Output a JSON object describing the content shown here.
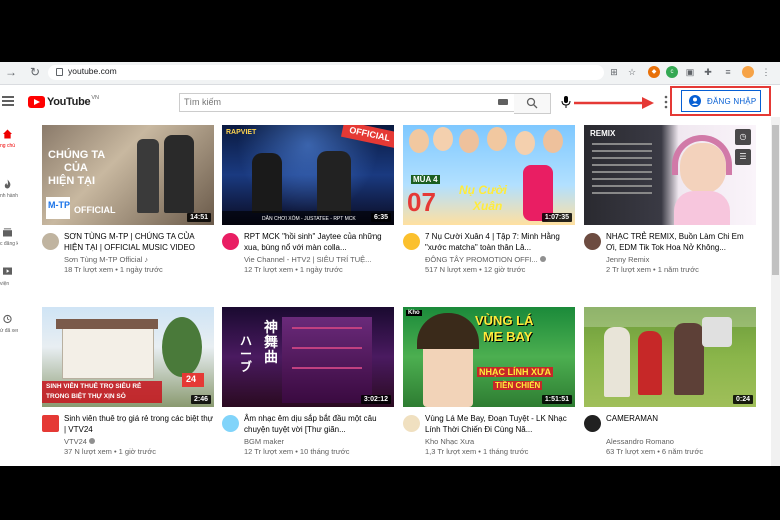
{
  "browser": {
    "url": "youtube.com"
  },
  "header": {
    "logo_text": "YouTube",
    "region": "VN",
    "search_placeholder": "Tìm kiếm",
    "signin_label": "ĐĂNG NHẬP",
    "colors": {
      "accent": "#065fd4",
      "brand": "#ff0000",
      "highlight": "#e53935"
    }
  },
  "sidebar": {
    "items": [
      {
        "label": "ng chủ",
        "icon": "home-icon"
      },
      {
        "label": "nh hành",
        "icon": "trending-icon"
      },
      {
        "label": "c đăng ký",
        "icon": "subscriptions-icon"
      },
      {
        "label": "viện",
        "icon": "library-icon"
      },
      {
        "label": "ử đã xem",
        "icon": "history-icon"
      }
    ]
  },
  "videos": [
    {
      "title": "SƠN TÙNG M-TP | CHÚNG TA CỦA HIỆN TẠI | OFFICIAL MUSIC VIDEO",
      "channel": "Sơn Tùng M-TP Official",
      "channel_badge": "♪",
      "stats": "18 Tr lượt xem • 1 ngày trước",
      "duration": "14:51",
      "overlay1": "CHÚNG TA",
      "overlay2": "CỦA",
      "overlay3": "HIỆN TẠI",
      "overlay4": "OFFICIAL",
      "overlay5": "M-TP"
    },
    {
      "title": "RPT MCK \"hồi sinh\" Jaytee của những xua, bùng nổ với màn colla...",
      "channel": "Vie Channel - HTV2 | SIÊU TRÍ TUỆ...",
      "stats": "12 Tr lượt xem • 1 ngày trước",
      "duration": "6:35",
      "overlay1": "OFFICIAL",
      "overlay2": "RAPVIET",
      "overlay3": "DÂN CHƠI XÓM - JUSTATEE - RPT MCK"
    },
    {
      "title": "7 Nụ Cười Xuân 4 | Tập 7: Minh Hằng \"xước matcha\" toàn thân Lâ...",
      "channel": "ĐÔNG TÂY PROMOTION OFFI...",
      "stats": "517 N lượt xem • 12 giờ trước",
      "duration": "1:07:35",
      "overlay1": "MÙA 4",
      "overlay2": "07",
      "overlay3": "Nụ Cười",
      "overlay4": "Xuân"
    },
    {
      "title": "NHẠC TRẺ REMIX, Buồn Làm Chi Em Ơi, EDM Tik Tok Hoa Nở Không...",
      "channel": "Jenny Remix",
      "stats": "2 Tr lượt xem • 1 năm trước",
      "duration": "",
      "overlay1": "REMIX"
    },
    {
      "title": "Sinh viên thuê trọ giá rẻ trong các biệt thự | VTV24",
      "channel": "VTV24",
      "stats": "37 N lượt xem • 1 giờ trước",
      "duration": "2:46",
      "overlay1": "SINH VIÊN THUÊ TRỌ SIÊU RẺ",
      "overlay2": "TRONG BIỆT THỰ XỊN SÒ",
      "overlay3": "24"
    },
    {
      "title": "Âm nhạc êm dịu sắp bắt đầu một câu chuyện tuyệt vời [Thư giãn...",
      "channel": "BGM maker",
      "stats": "12 Tr lượt xem • 10 tháng trước",
      "duration": "3:02:12",
      "overlay1": "神舞曲",
      "overlay2": "ハーブ"
    },
    {
      "title": "Vùng Lá Me Bay, Đoạn Tuyệt - LK Nhạc Lính Thời Chiến Đi Cùng Nă...",
      "channel": "Kho Nhạc Xưa",
      "stats": "1,3 Tr lượt xem • 1 tháng trước",
      "duration": "1:51:51",
      "overlay1": "VÙNG LÁ",
      "overlay2": "ME BAY",
      "overlay3": "NHẠC LÍNH XƯA",
      "overlay4": "TIỀN CHIẾN"
    },
    {
      "title": "CAMERAMAN",
      "channel": "Alessandro Romano",
      "stats": "63 Tr lượt xem • 6 năm trước",
      "duration": "0:24"
    }
  ]
}
